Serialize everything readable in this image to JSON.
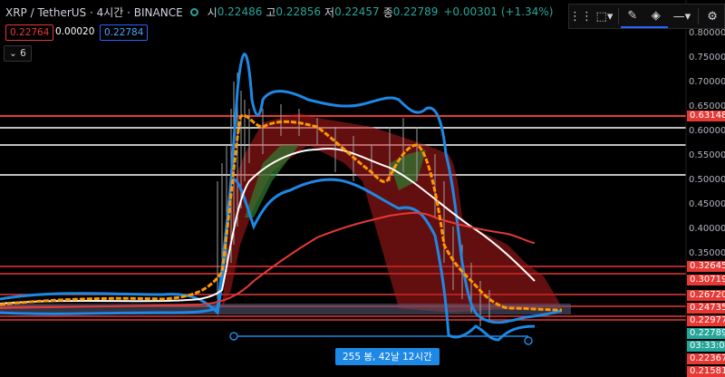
{
  "header": {
    "symbol": "XRP / TetherUS · 4시간 · BINANCE",
    "open_label": "시",
    "open": "0.22486",
    "high_label": "고",
    "high": "0.22856",
    "low_label": "저",
    "low": "0.22457",
    "close_label": "종",
    "close": "0.22789",
    "change": "+0.00301 (+1.34%)"
  },
  "price_boxes": {
    "sell": "0.22764",
    "spread": "0.00020",
    "buy": "0.22784"
  },
  "indicators_toggle": "6",
  "toolbar": {
    "icons": [
      "grip-icon",
      "rectangle-select-icon",
      "pencil-icon",
      "fill-bucket-icon",
      "line-style-icon",
      "settings-gear-icon"
    ]
  },
  "measure_label": "255 봉, 42날 12시간",
  "price_axis": {
    "ticks": [
      "0.80000",
      "0.75000",
      "0.70000",
      "0.65000",
      "0.60000",
      "0.55000",
      "0.50000",
      "0.45000",
      "0.40000",
      "0.35000"
    ],
    "levels": [
      {
        "label": "0.63148",
        "color": "#e53935"
      },
      {
        "label": "0.32645",
        "color": "#e53935"
      },
      {
        "label": "0.30719",
        "color": "#e53935"
      },
      {
        "label": "0.26720",
        "color": "#e53935"
      },
      {
        "label": "0.24735",
        "color": "#e53935"
      },
      {
        "label": "0.22977",
        "color": "#e53935"
      },
      {
        "label": "0.22789",
        "color": "#26a69a"
      },
      {
        "label": "03:33:02",
        "color": "#26a69a"
      },
      {
        "label": "0.22367",
        "color": "#e53935"
      },
      {
        "label": "0.21581",
        "color": "#e53935"
      }
    ]
  },
  "colors": {
    "accent": "#26a69a",
    "red": "#e53935",
    "blue": "#1e88e5",
    "orange": "#ff9800",
    "white": "#ffffff"
  }
}
